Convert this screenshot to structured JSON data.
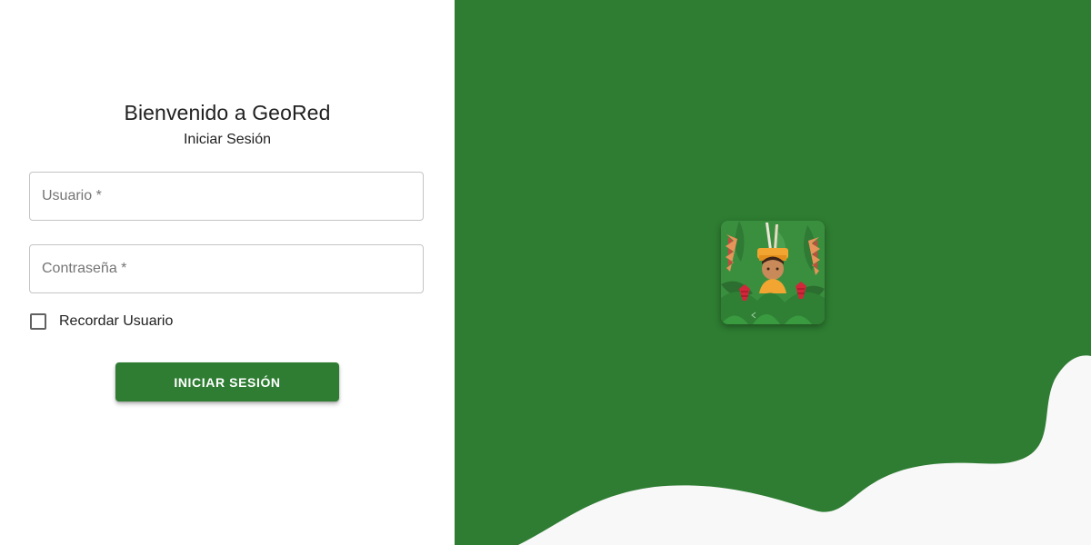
{
  "login": {
    "title": "Bienvenido a GeoRed",
    "subtitle": "Iniciar Sesión",
    "username_placeholder": "Usuario *",
    "username_value": "",
    "password_placeholder": "Contraseña *",
    "password_value": "",
    "remember_label": "Recordar Usuario",
    "remember_checked": false,
    "submit_label": "INICIAR SESIÓN"
  },
  "theme": {
    "primary": "#2e7d32",
    "wave": "#f8f8f8"
  },
  "icons": {
    "logo": "geored-logo-icon",
    "checkbox": "checkbox-unchecked-icon"
  }
}
